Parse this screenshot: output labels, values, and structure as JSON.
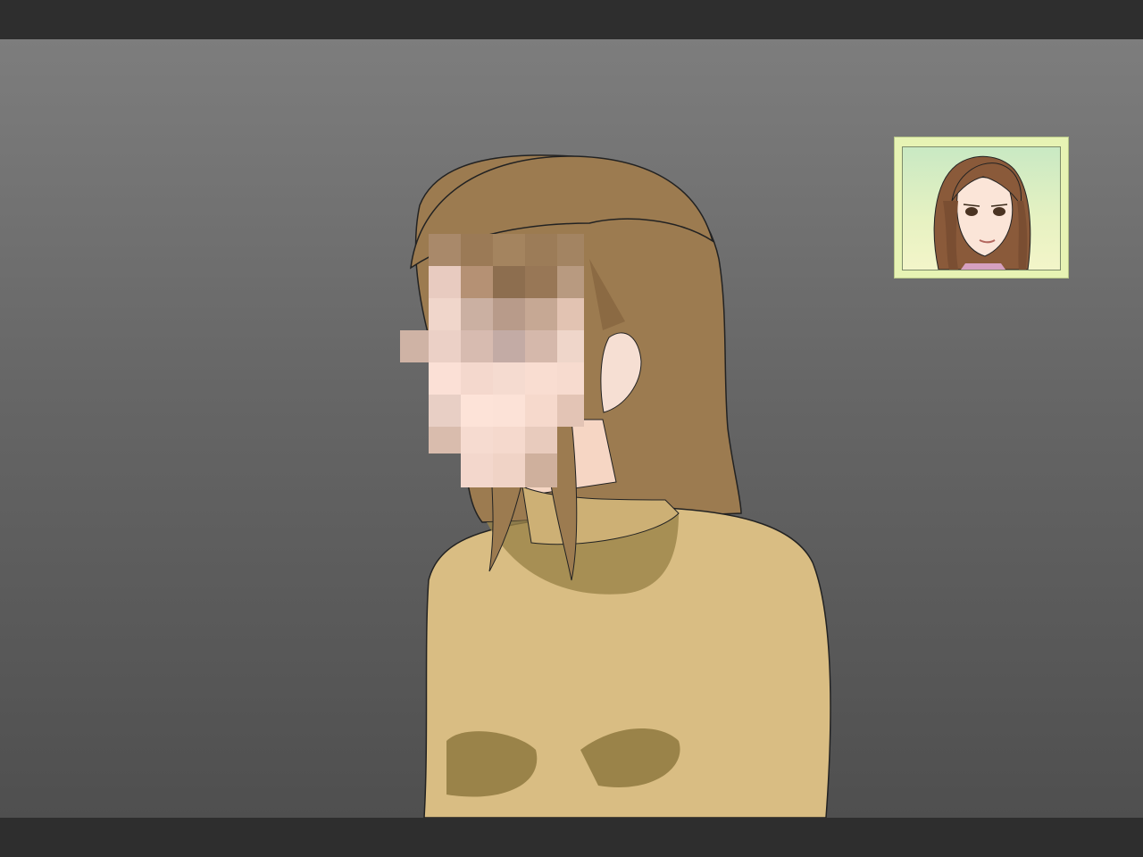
{
  "scene": {
    "background_colors": [
      "#7d7d7d",
      "#4f4f4f"
    ],
    "letterbox_color": "#2e2e2e",
    "character": {
      "hair_color": "#9c7b50",
      "sweater_color": "#d9bd83",
      "face_censored": true
    }
  },
  "portrait": {
    "frame_color": "#e7f3b4",
    "background_colors": [
      "#c9e9c3",
      "#f3f5c9"
    ],
    "hair_color": "#8a5a3a"
  }
}
